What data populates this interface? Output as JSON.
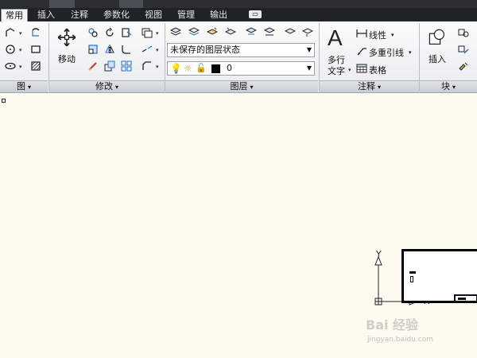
{
  "tabs": [
    {
      "label": "常用",
      "active": true
    },
    {
      "label": "插入",
      "active": false
    },
    {
      "label": "注释",
      "active": false
    },
    {
      "label": "参数化",
      "active": false
    },
    {
      "label": "视图",
      "active": false
    },
    {
      "label": "管理",
      "active": false
    },
    {
      "label": "输出",
      "active": false
    }
  ],
  "panels": {
    "draw": {
      "footer": "图"
    },
    "modify": {
      "footer": "修改",
      "move_label": "移动"
    },
    "layers": {
      "footer": "图层",
      "layer_state": "未保存的图层状态",
      "current_layer": "0"
    },
    "annotation": {
      "footer": "注释",
      "mtext_line1": "多行",
      "mtext_line2": "文字",
      "linear": "线性",
      "multileader": "多重引线",
      "table": "表格"
    },
    "block": {
      "footer": "块",
      "insert_label": "插入"
    }
  },
  "canvas": {
    "y_axis": "Y",
    "x_axis": "X"
  },
  "watermark": {
    "logo": "Bai 经验",
    "url": "jingyan.baidu.com"
  },
  "colors": {
    "canvas_bg": "#fdfaf0",
    "ribbon_bg": "#eeeff1",
    "tabbar_bg": "#1f2227"
  }
}
